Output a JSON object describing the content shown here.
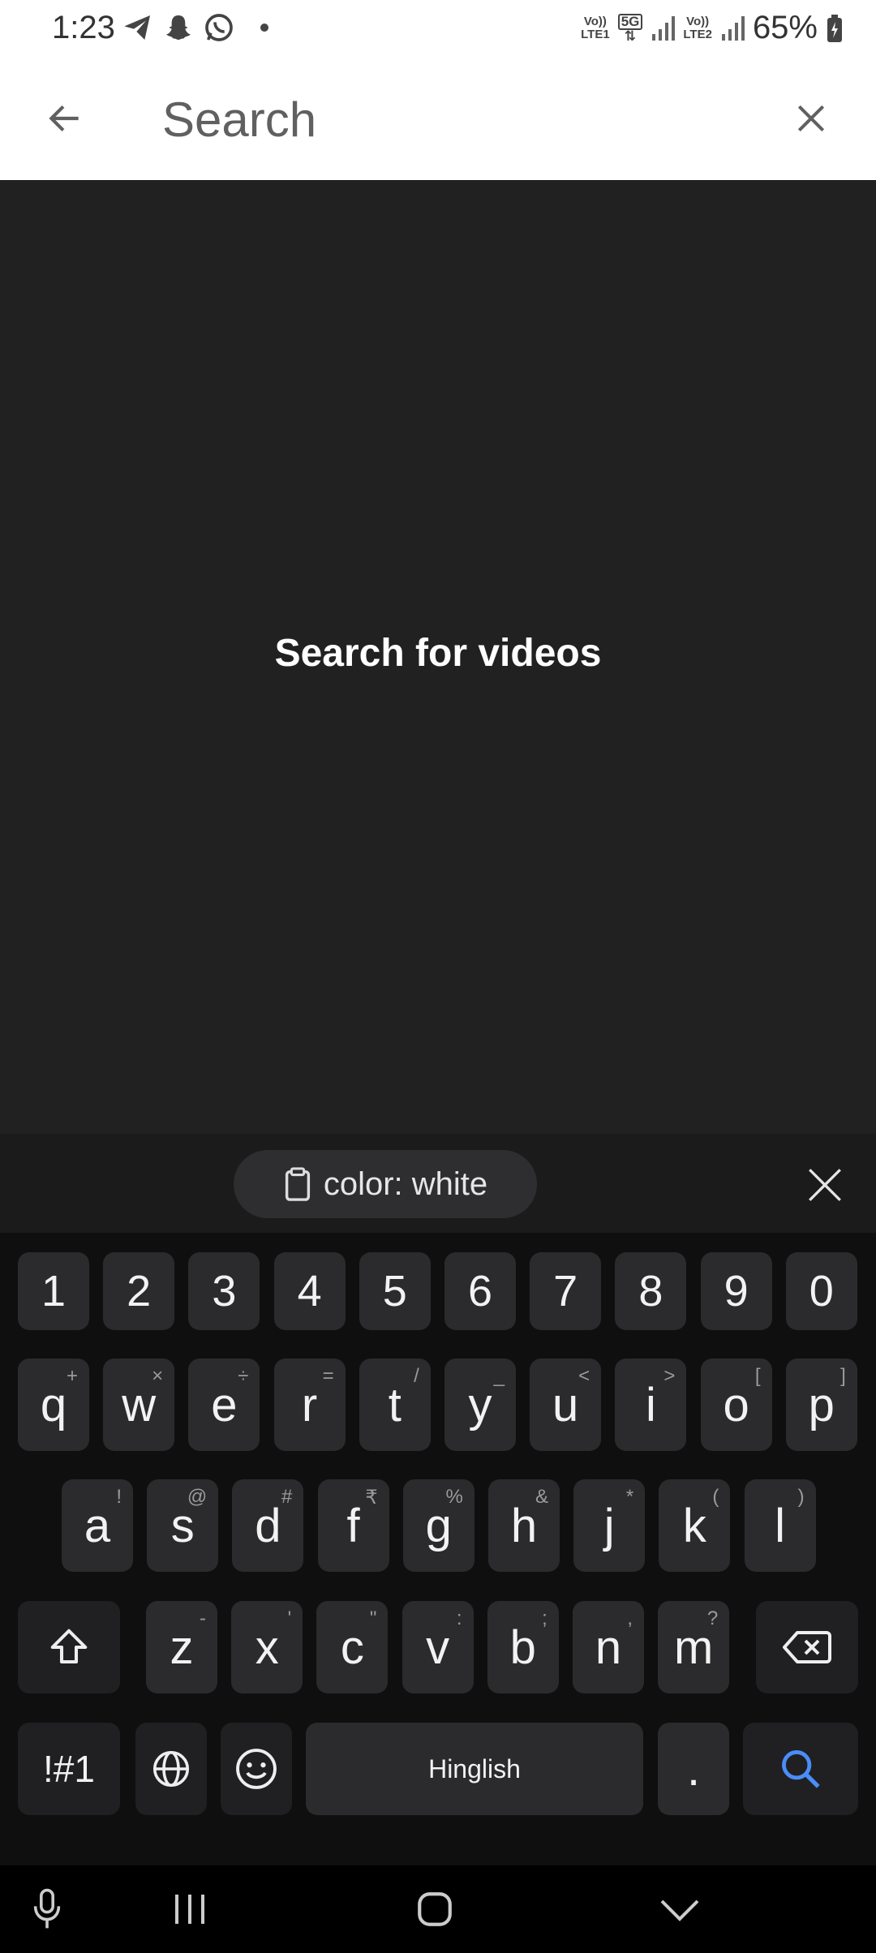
{
  "status_bar": {
    "time": "1:23",
    "battery": "65%",
    "sim1_label_top": "Vo))",
    "sim1_label_bottom": "LTE1",
    "network": "5G",
    "sim2_label_top": "Vo))",
    "sim2_label_bottom": "LTE2",
    "icons": [
      "telegram-icon",
      "snapchat-icon",
      "whatsapp-icon",
      "dot-icon"
    ]
  },
  "app_bar": {
    "search_placeholder": "Search",
    "back_icon": "arrow-left-icon",
    "clear_icon": "close-icon"
  },
  "content": {
    "empty_message": "Search for videos"
  },
  "keyboard": {
    "clipboard_suggestion": "color: white",
    "number_row": [
      "1",
      "2",
      "3",
      "4",
      "5",
      "6",
      "7",
      "8",
      "9",
      "0"
    ],
    "row1": [
      {
        "key": "q",
        "sub": "+"
      },
      {
        "key": "w",
        "sub": "×"
      },
      {
        "key": "e",
        "sub": "÷"
      },
      {
        "key": "r",
        "sub": "="
      },
      {
        "key": "t",
        "sub": "/"
      },
      {
        "key": "y",
        "sub": "_"
      },
      {
        "key": "u",
        "sub": "<"
      },
      {
        "key": "i",
        "sub": ">"
      },
      {
        "key": "o",
        "sub": "["
      },
      {
        "key": "p",
        "sub": "]"
      }
    ],
    "row2": [
      {
        "key": "a",
        "sub": "!"
      },
      {
        "key": "s",
        "sub": "@"
      },
      {
        "key": "d",
        "sub": "#"
      },
      {
        "key": "f",
        "sub": "₹"
      },
      {
        "key": "g",
        "sub": "%"
      },
      {
        "key": "h",
        "sub": "&"
      },
      {
        "key": "j",
        "sub": "*"
      },
      {
        "key": "k",
        "sub": "("
      },
      {
        "key": "l",
        "sub": ")"
      }
    ],
    "row3": [
      {
        "key": "z",
        "sub": "-"
      },
      {
        "key": "x",
        "sub": "'"
      },
      {
        "key": "c",
        "sub": "\""
      },
      {
        "key": "v",
        "sub": ":"
      },
      {
        "key": "b",
        "sub": ";"
      },
      {
        "key": "n",
        "sub": ","
      },
      {
        "key": "m",
        "sub": "?"
      }
    ],
    "symbols_key": "!#1",
    "space_label": "Hinglish",
    "period_key": ".",
    "accent_color": "#4a8df8"
  }
}
